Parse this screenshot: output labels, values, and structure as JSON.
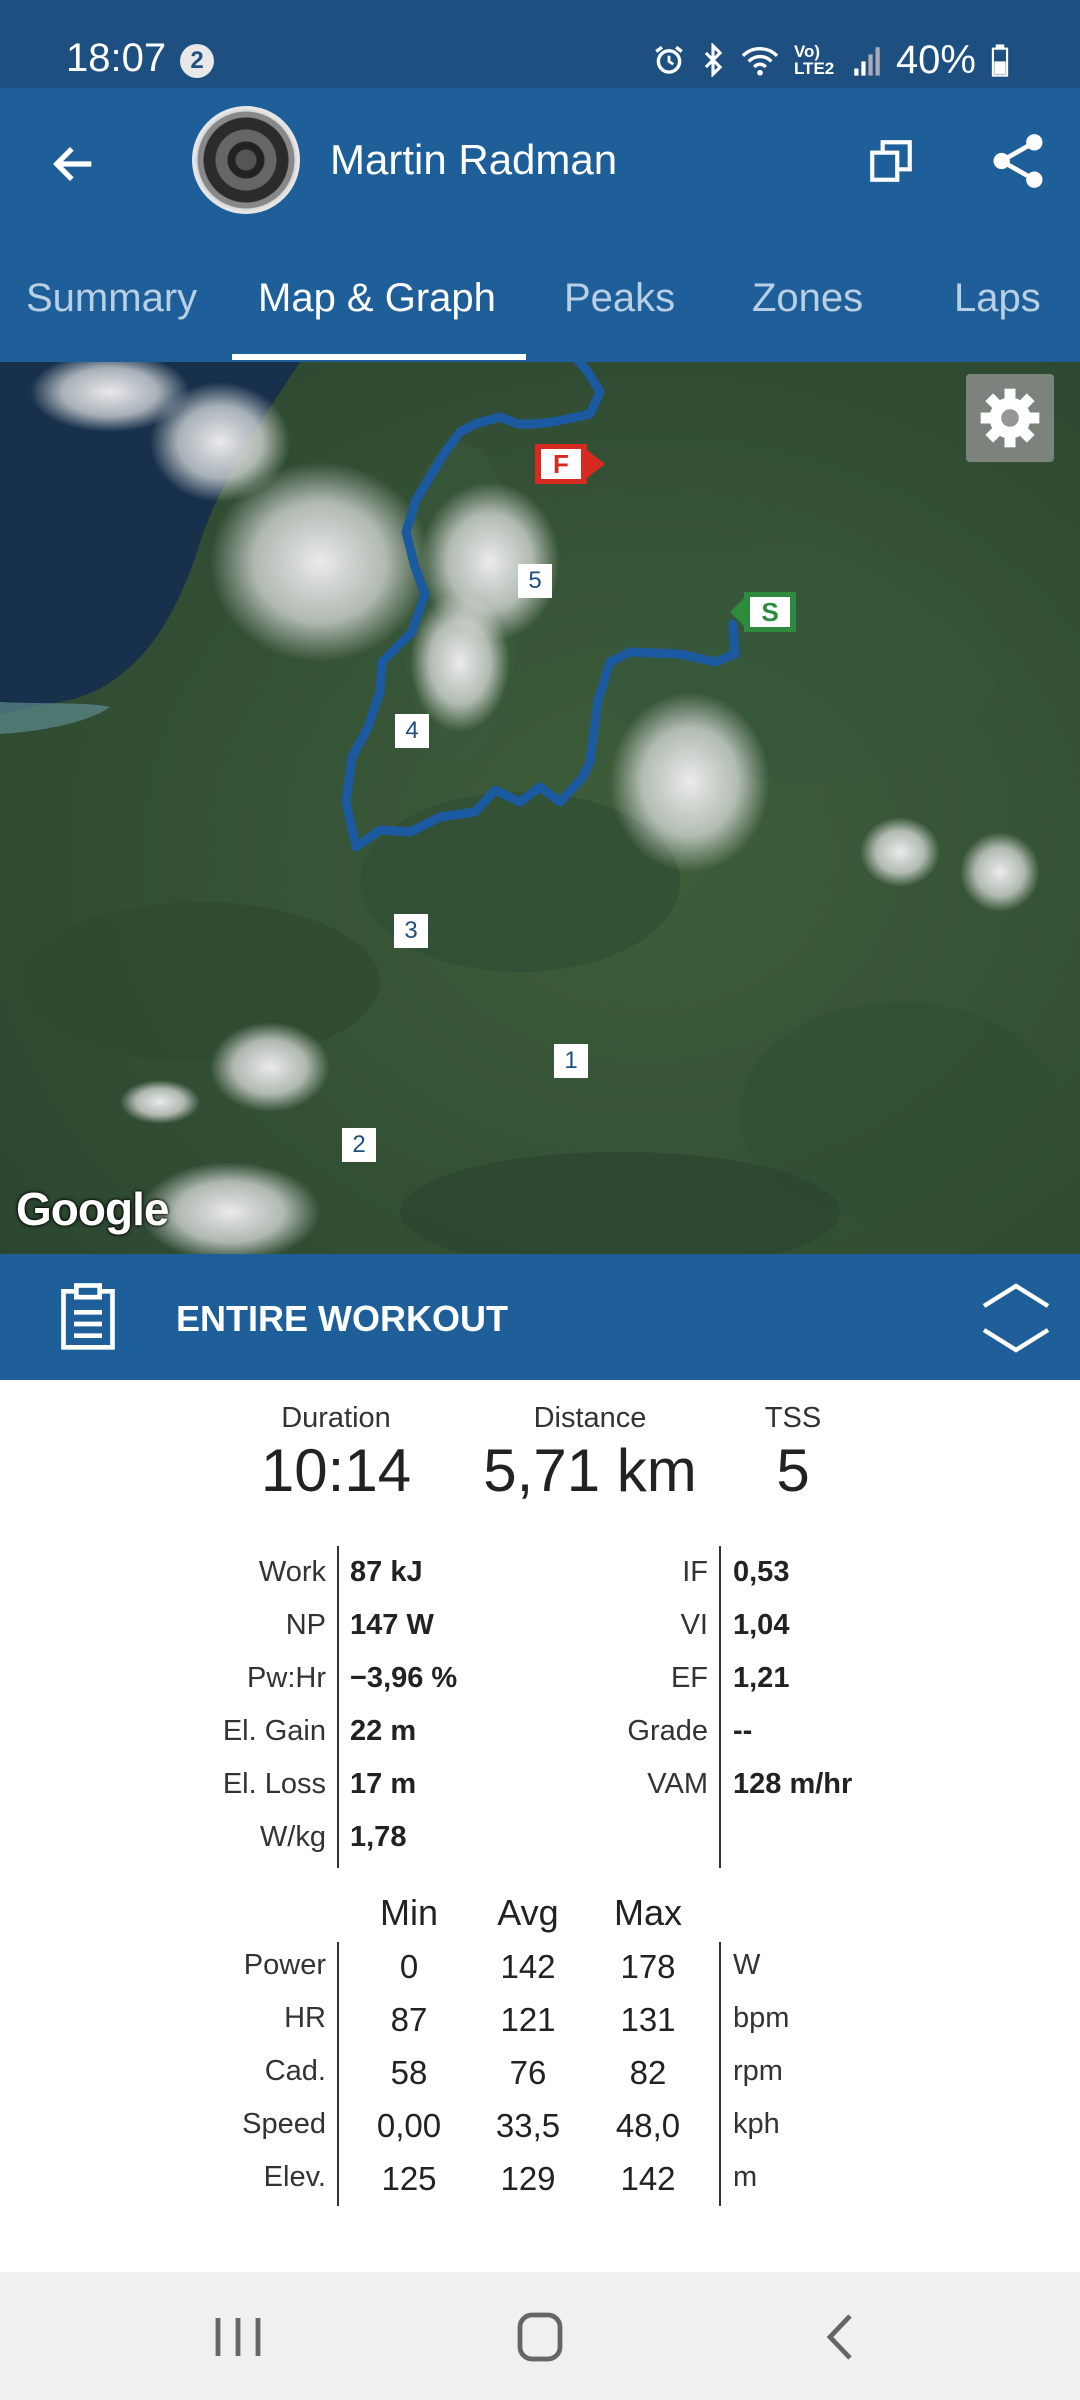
{
  "status_bar": {
    "time": "18:07",
    "notification_count": "2",
    "network": "Vo) LTE2",
    "battery": "40%",
    "icons": [
      "alarm-icon",
      "bluetooth-icon",
      "wifi-icon",
      "signal-icon",
      "battery-icon"
    ]
  },
  "app_bar": {
    "title": "Martin Radman",
    "icons": [
      "back-arrow-icon",
      "avatar",
      "copy-icon",
      "share-icon"
    ]
  },
  "tabs": [
    {
      "label": "Summary",
      "active": false
    },
    {
      "label": "Map & Graph",
      "active": true
    },
    {
      "label": "Peaks",
      "active": false
    },
    {
      "label": "Zones",
      "active": false
    },
    {
      "label": "Laps",
      "active": false
    }
  ],
  "map": {
    "start_label": "S",
    "finish_label": "F",
    "lap_markers": [
      "1",
      "2",
      "3",
      "4",
      "5"
    ],
    "attribution": "Google",
    "route_color": "#1b5aa0",
    "start_color": "#2e8b3e",
    "finish_color": "#d62a20"
  },
  "panel": {
    "title": "ENTIRE WORKOUT"
  },
  "summary": {
    "duration_label": "Duration",
    "duration_value": "10:14",
    "distance_label": "Distance",
    "distance_value": "5,71 km",
    "tss_label": "TSS",
    "tss_value": "5"
  },
  "stats_left": [
    {
      "label": "Work",
      "value": "87 kJ"
    },
    {
      "label": "NP",
      "value": "147 W"
    },
    {
      "label": "Pw:Hr",
      "value": "−3,96 %"
    },
    {
      "label": "El. Gain",
      "value": "22 m"
    },
    {
      "label": "El. Loss",
      "value": "17 m"
    },
    {
      "label": "W/kg",
      "value": "1,78"
    }
  ],
  "stats_right": [
    {
      "label": "IF",
      "value": "0,53"
    },
    {
      "label": "VI",
      "value": "1,04"
    },
    {
      "label": "EF",
      "value": "1,21"
    },
    {
      "label": "Grade",
      "value": "--"
    },
    {
      "label": "VAM",
      "value": "128 m/hr"
    }
  ],
  "table": {
    "headers": [
      "Min",
      "Avg",
      "Max"
    ],
    "rows": [
      {
        "label": "Power",
        "min": "0",
        "avg": "142",
        "max": "178",
        "unit": "W"
      },
      {
        "label": "HR",
        "min": "87",
        "avg": "121",
        "max": "131",
        "unit": "bpm"
      },
      {
        "label": "Cad.",
        "min": "58",
        "avg": "76",
        "max": "82",
        "unit": "rpm"
      },
      {
        "label": "Speed",
        "min": "0,00",
        "avg": "33,5",
        "max": "48,0",
        "unit": "kph"
      },
      {
        "label": "Elev.",
        "min": "125",
        "avg": "129",
        "max": "142",
        "unit": "m"
      }
    ]
  },
  "nav_bar": {
    "icons": [
      "recent-apps-icon",
      "home-icon",
      "back-icon"
    ]
  }
}
